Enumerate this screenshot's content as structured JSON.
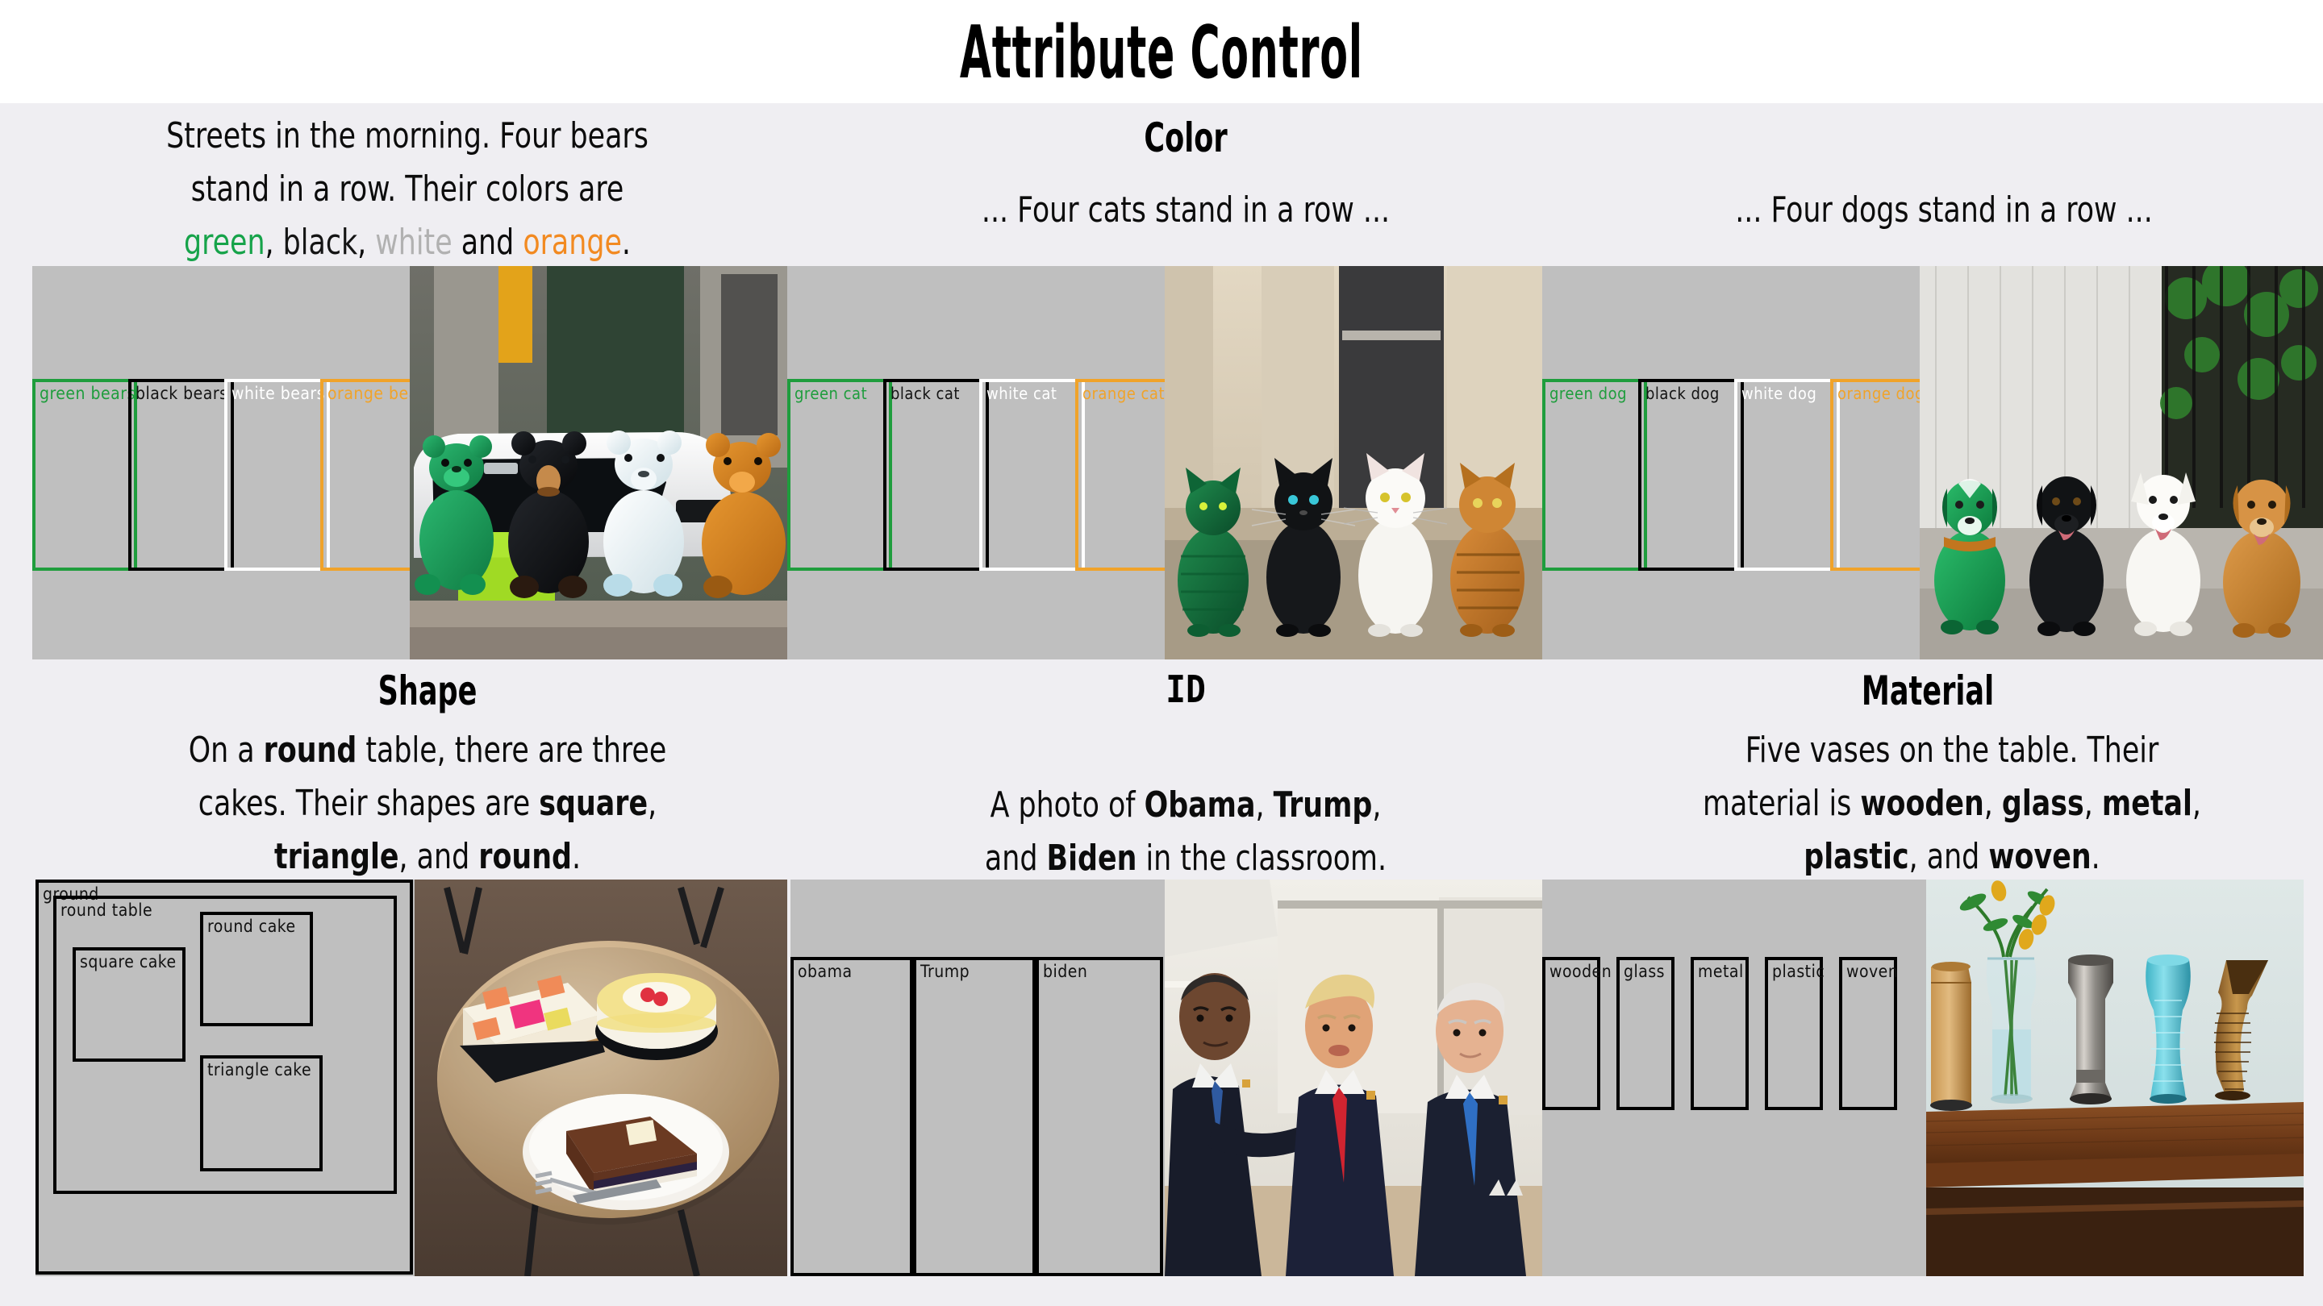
{
  "figure": {
    "title": "Attribute Control",
    "background_color": "#efeef2",
    "layout_fill_color": "#bfbfbf"
  },
  "colors": {
    "green": "#16a34a",
    "black": "#141414",
    "white": "#b1b1b1",
    "orange": "#f28a21",
    "box_green": "#1f9d3d",
    "box_black": "#000000",
    "box_white": "#ffffff",
    "box_orange": "#f0a32a"
  },
  "sections": [
    {
      "id": "color",
      "heading": "Color",
      "cases": [
        {
          "id": "bears",
          "prompt_lines": [
            [
              {
                "t": "Streets in the morning. Four bears",
                "c": "k"
              }
            ],
            [
              {
                "t": "stand in a row. Their colors are",
                "c": "k"
              }
            ],
            [
              {
                "t": "green",
                "c": "g"
              },
              {
                "t": ", ",
                "c": "k"
              },
              {
                "t": "black",
                "c": "k"
              },
              {
                "t": ", ",
                "c": "k"
              },
              {
                "t": "white",
                "c": "w"
              },
              {
                "t": " and ",
                "c": "k"
              },
              {
                "t": "orange",
                "c": "o"
              },
              {
                "t": ".",
                "c": "k"
              }
            ]
          ],
          "boxes": [
            {
              "label": "green bears",
              "color": "#1f9d3d"
            },
            {
              "label": "black bears",
              "color": "#000000"
            },
            {
              "label": "white bears",
              "color": "#ffffff"
            },
            {
              "label": "orange bears",
              "color": "#f0a32a"
            }
          ],
          "image_caption": "four plush bears green black white orange sitting on a curb in front of a white van"
        },
        {
          "id": "cats",
          "prompt_lines": [
            [
              {
                "t": "... Four cats stand in a row ...",
                "c": "k"
              }
            ]
          ],
          "boxes": [
            {
              "label": "green cat",
              "color": "#1f9d3d"
            },
            {
              "label": "black  cat",
              "color": "#000000"
            },
            {
              "label": "white  cat",
              "color": "#ffffff"
            },
            {
              "label": "orange  cat",
              "color": "#f0a32a"
            }
          ],
          "image_caption": "four cats green black white orange standing in a row by a stone wall"
        },
        {
          "id": "dogs",
          "prompt_lines": [
            [
              {
                "t": "... Four dogs stand in a row ...",
                "c": "k"
              }
            ]
          ],
          "boxes": [
            {
              "label": "green dog",
              "color": "#1f9d3d"
            },
            {
              "label": "black dog",
              "color": "#000000"
            },
            {
              "label": "white dog",
              "color": "#ffffff"
            },
            {
              "label": "orange dog",
              "color": "#f0a32a"
            }
          ],
          "image_caption": "four dogs green black white orange standing in a row on a pavement"
        }
      ]
    },
    {
      "id": "shape",
      "heading": "Shape",
      "cases": [
        {
          "id": "cakes",
          "prompt_lines": [
            [
              {
                "t": "On a ",
                "c": "k"
              },
              {
                "t": "round",
                "c": "k",
                "b": true
              },
              {
                "t": " table, there are three",
                "c": "k"
              }
            ],
            [
              {
                "t": "cakes. Their shapes are ",
                "c": "k"
              },
              {
                "t": "square",
                "c": "k",
                "b": true
              },
              {
                "t": ",",
                "c": "k"
              }
            ],
            [
              {
                "t": "triangle",
                "c": "k",
                "b": true
              },
              {
                "t": ", and ",
                "c": "k"
              },
              {
                "t": "round",
                "c": "k",
                "b": true
              },
              {
                "t": ".",
                "c": "k"
              }
            ]
          ],
          "boxes": [
            {
              "label": "ground",
              "color": "#000000"
            },
            {
              "label": "round table",
              "color": "#000000"
            },
            {
              "label": "square cake",
              "color": "#000000"
            },
            {
              "label": "round cake",
              "color": "#000000"
            },
            {
              "label": "triangle cake",
              "color": "#000000"
            }
          ],
          "image_caption": "square cake, round cake and triangular cake slice on a round table"
        }
      ]
    },
    {
      "id": "identity",
      "heading": "ID",
      "cases": [
        {
          "id": "politicians",
          "prompt_lines": [
            [
              {
                "t": "A photo of ",
                "c": "k"
              },
              {
                "t": "Obama",
                "c": "k",
                "b": true
              },
              {
                "t": ", ",
                "c": "k"
              },
              {
                "t": "Trump",
                "c": "k",
                "b": true
              },
              {
                "t": ",",
                "c": "k"
              }
            ],
            [
              {
                "t": "and ",
                "c": "k"
              },
              {
                "t": "Biden",
                "c": "k",
                "b": true
              },
              {
                "t": " in the classroom.",
                "c": "k"
              }
            ]
          ],
          "boxes": [
            {
              "label": "obama",
              "color": "#000000"
            },
            {
              "label": "Trump",
              "color": "#000000"
            },
            {
              "label": "biden",
              "color": "#000000"
            }
          ],
          "image_caption": "Obama, Trump and Biden standing in a classroom"
        }
      ]
    },
    {
      "id": "material",
      "heading": "Material",
      "cases": [
        {
          "id": "vases",
          "prompt_lines": [
            [
              {
                "t": "Five vases on the table. Their",
                "c": "k"
              }
            ],
            [
              {
                "t": "material is ",
                "c": "k"
              },
              {
                "t": "wooden",
                "c": "k",
                "b": true
              },
              {
                "t": ", ",
                "c": "k"
              },
              {
                "t": "glass",
                "c": "k",
                "b": true
              },
              {
                "t": ", ",
                "c": "k"
              },
              {
                "t": "metal",
                "c": "k",
                "b": true
              },
              {
                "t": ",",
                "c": "k"
              }
            ],
            [
              {
                "t": "plastic",
                "c": "k",
                "b": true
              },
              {
                "t": ", and ",
                "c": "k"
              },
              {
                "t": "woven",
                "c": "k",
                "b": true
              },
              {
                "t": ".",
                "c": "k"
              }
            ]
          ],
          "boxes": [
            {
              "label": "wooden",
              "color": "#000000"
            },
            {
              "label": "glass",
              "color": "#000000"
            },
            {
              "label": "metal",
              "color": "#000000"
            },
            {
              "label": "plastic",
              "color": "#000000"
            },
            {
              "label": "woven",
              "color": "#000000"
            }
          ],
          "image_caption": "five vases wooden glass metal plastic woven on a wooden table"
        }
      ]
    }
  ]
}
